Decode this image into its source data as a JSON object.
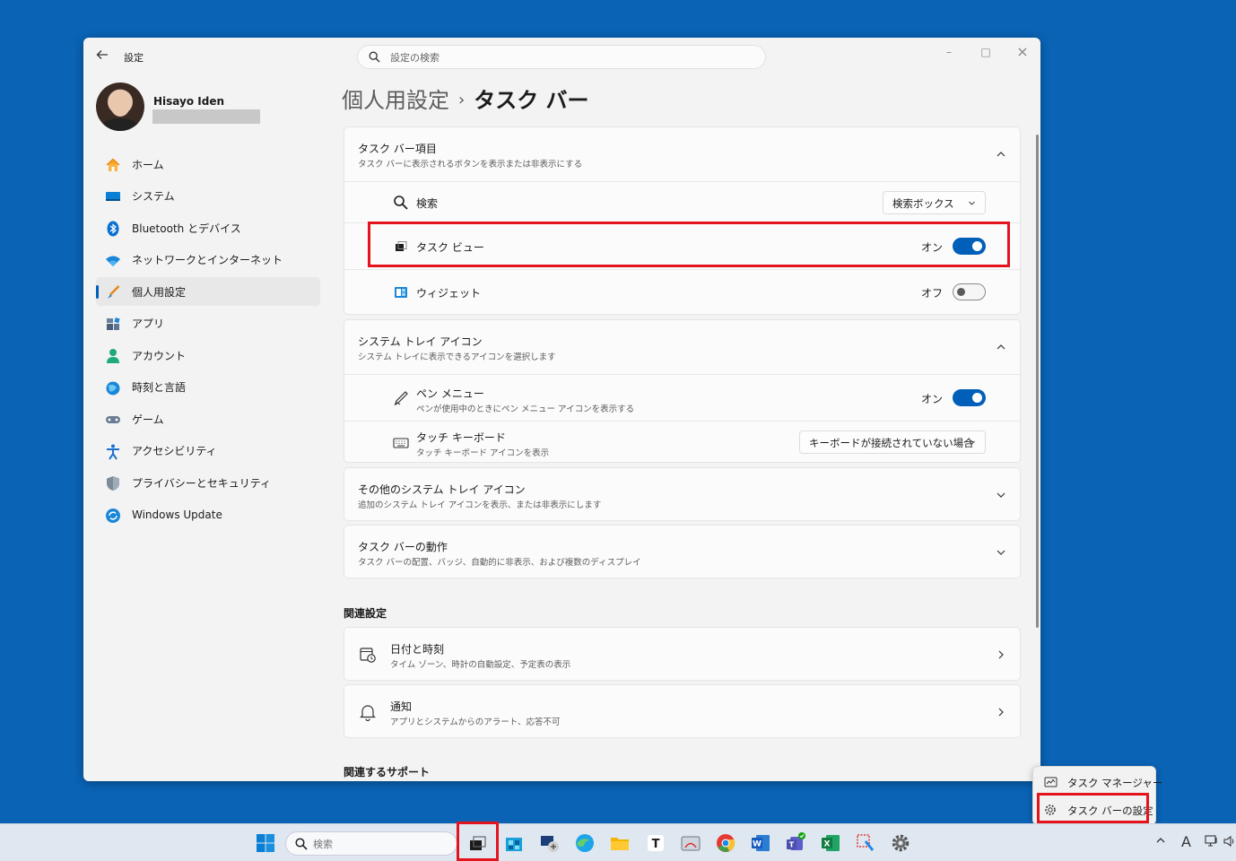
{
  "window": {
    "app_title": "設定",
    "search_placeholder": "設定の検索",
    "controls": {
      "minimize": "–",
      "maximize": "□",
      "close": "×"
    }
  },
  "profile": {
    "name": "Hisayo Iden"
  },
  "nav": {
    "items": [
      {
        "label": "ホーム",
        "icon": "home-icon"
      },
      {
        "label": "システム",
        "icon": "system-icon"
      },
      {
        "label": "Bluetooth とデバイス",
        "icon": "bluetooth-icon"
      },
      {
        "label": "ネットワークとインターネット",
        "icon": "network-icon"
      },
      {
        "label": "個人用設定",
        "icon": "brush-icon",
        "active": true
      },
      {
        "label": "アプリ",
        "icon": "apps-icon"
      },
      {
        "label": "アカウント",
        "icon": "account-icon"
      },
      {
        "label": "時刻と言語",
        "icon": "time-language-icon"
      },
      {
        "label": "ゲーム",
        "icon": "gaming-icon"
      },
      {
        "label": "アクセシビリティ",
        "icon": "accessibility-icon"
      },
      {
        "label": "プライバシーとセキュリティ",
        "icon": "shield-icon"
      },
      {
        "label": "Windows Update",
        "icon": "windows-update-icon"
      }
    ]
  },
  "breadcrumb": {
    "parent": "個人用設定",
    "separator": "›",
    "current": "タスク バー"
  },
  "taskbar_items": {
    "title": "タスク バー項目",
    "subtitle": "タスク バーに表示されるボタンを表示または非表示にする",
    "search": {
      "label": "検索",
      "value": "検索ボックス"
    },
    "task_view": {
      "label": "タスク ビュー",
      "state": "オン"
    },
    "widgets": {
      "label": "ウィジェット",
      "state": "オフ"
    }
  },
  "system_tray": {
    "title": "システム トレイ アイコン",
    "subtitle": "システム トレイに表示できるアイコンを選択します",
    "pen_menu": {
      "label": "ペン メニュー",
      "sub": "ペンが使用中のときにペン メニュー アイコンを表示する",
      "state": "オン"
    },
    "touch_keyboard": {
      "label": "タッチ キーボード",
      "sub": "タッチ キーボード アイコンを表示",
      "value": "キーボードが接続されていない場合"
    }
  },
  "other_tray": {
    "title": "その他のシステム トレイ アイコン",
    "subtitle": "追加のシステム トレイ アイコンを表示、または非表示にします"
  },
  "behaviors": {
    "title": "タスク バーの動作",
    "subtitle": "タスク バーの配置、バッジ、自動的に非表示、および複数のディスプレイ"
  },
  "related": {
    "heading": "関連設定",
    "date_time": {
      "title": "日付と時刻",
      "subtitle": "タイム ゾーン、時計の自動設定、予定表の表示"
    },
    "notifications": {
      "title": "通知",
      "subtitle": "アプリとシステムからのアラート、応答不可"
    }
  },
  "support": {
    "heading": "関連するサポート"
  },
  "context_menu": {
    "task_manager": "タスク マネージャー",
    "taskbar_settings": "タスク バーの設定"
  },
  "taskbar": {
    "search_placeholder": "検索",
    "tray_a": "A"
  },
  "colors": {
    "accent": "#005fb8",
    "highlight": "#e3141e",
    "desktop": "#0a63b5"
  }
}
